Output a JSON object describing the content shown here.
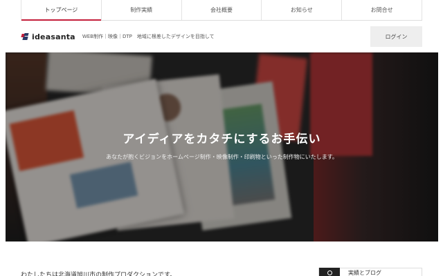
{
  "nav": {
    "items": [
      {
        "label": "トップページ",
        "active": true
      },
      {
        "label": "制作実績",
        "active": false
      },
      {
        "label": "会社概要",
        "active": false
      },
      {
        "label": "お知らせ",
        "active": false
      },
      {
        "label": "お問合せ",
        "active": false
      }
    ],
    "active_color": "#c41e3a"
  },
  "header": {
    "logo_text": "ideasanta",
    "tagline": "WEB制作｜映像｜DTP　地域に根差したデザインを目指して",
    "login_label": "ログイン"
  },
  "hero": {
    "heading": "アイディアをカタチにするお手伝い",
    "subtext": "あなたが抱くビジョンをホームページ制作・映像制作・印刷物といった制作物にいたします。"
  },
  "intro": {
    "text": "わたしたちは北海道旭川市の制作プロダクションです。"
  },
  "side_card": {
    "icon": "info-icon",
    "label": "実績とブログ"
  }
}
